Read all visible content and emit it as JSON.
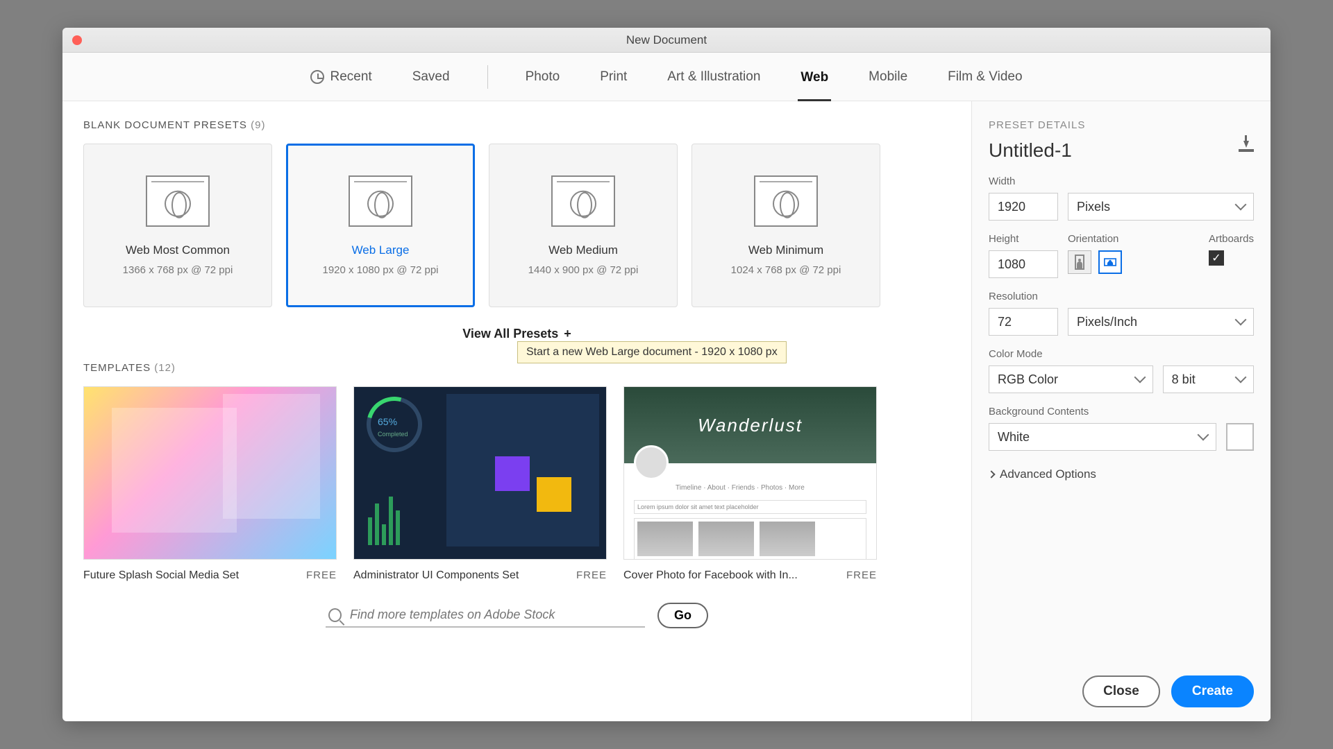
{
  "titlebar": {
    "title": "New Document"
  },
  "nav": {
    "recent": "Recent",
    "saved": "Saved",
    "photo": "Photo",
    "print": "Print",
    "art": "Art & Illustration",
    "web": "Web",
    "mobile": "Mobile",
    "film": "Film & Video"
  },
  "presets": {
    "section_label": "BLANK DOCUMENT PRESETS",
    "count": "(9)",
    "items": [
      {
        "name": "Web Most Common",
        "dims": "1366 x 768 px @ 72 ppi"
      },
      {
        "name": "Web Large",
        "dims": "1920 x 1080 px @ 72 ppi"
      },
      {
        "name": "Web Medium",
        "dims": "1440 x 900 px @ 72 ppi"
      },
      {
        "name": "Web Minimum",
        "dims": "1024 x 768 px @ 72 ppi"
      }
    ],
    "tooltip": "Start a new Web Large document - 1920 x 1080 px",
    "view_all": "View All Presets"
  },
  "templates": {
    "section_label": "TEMPLATES",
    "count": "(12)",
    "items": [
      {
        "name": "Future Splash Social Media Set",
        "badge": "FREE"
      },
      {
        "name": "Administrator UI Components Set",
        "badge": "FREE"
      },
      {
        "name": "Cover Photo for Facebook with In...",
        "badge": "FREE"
      }
    ],
    "thumb2_pct": "65%",
    "thumb2_sub": "Completed",
    "thumb3_word": "Wanderlust",
    "thumb3_tabs": "Timeline · About · Friends · Photos · More"
  },
  "search": {
    "placeholder": "Find more templates on Adobe Stock",
    "go": "Go"
  },
  "details": {
    "section_label": "PRESET DETAILS",
    "doc_name": "Untitled-1",
    "width_label": "Width",
    "width_value": "1920",
    "units": "Pixels",
    "height_label": "Height",
    "height_value": "1080",
    "orientation_label": "Orientation",
    "artboards_label": "Artboards",
    "resolution_label": "Resolution",
    "resolution_value": "72",
    "resolution_units": "Pixels/Inch",
    "color_mode_label": "Color Mode",
    "color_mode_value": "RGB Color",
    "bit_depth": "8 bit",
    "bg_label": "Background Contents",
    "bg_value": "White",
    "advanced": "Advanced Options"
  },
  "footer": {
    "close": "Close",
    "create": "Create"
  }
}
